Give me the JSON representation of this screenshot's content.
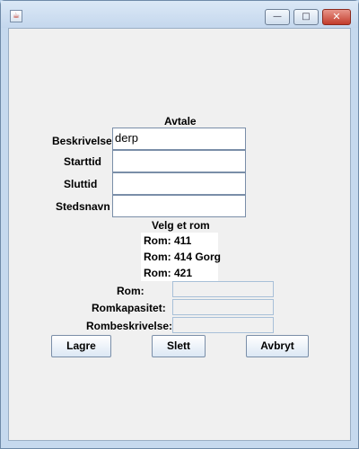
{
  "window": {
    "title": "",
    "controls": {
      "minimize": "—",
      "maximize": "□",
      "close": "✕"
    }
  },
  "form": {
    "heading": "Avtale",
    "fields": [
      {
        "label": "Beskrivelse",
        "value": "derp"
      },
      {
        "label": "Starttid",
        "value": ""
      },
      {
        "label": "Sluttid",
        "value": ""
      },
      {
        "label": "Stedsnavn",
        "value": ""
      }
    ],
    "room_list_heading": "Velg et rom",
    "rooms": [
      "Rom: 411",
      "Rom: 414 Gorg",
      "Rom: 421"
    ],
    "room_details": [
      {
        "label": "Rom:",
        "value": ""
      },
      {
        "label": "Romkapasitet:",
        "value": ""
      },
      {
        "label": "Rombeskrivelse:",
        "value": ""
      }
    ]
  },
  "buttons": {
    "save": "Lagre",
    "delete": "Slett",
    "cancel": "Avbryt"
  }
}
